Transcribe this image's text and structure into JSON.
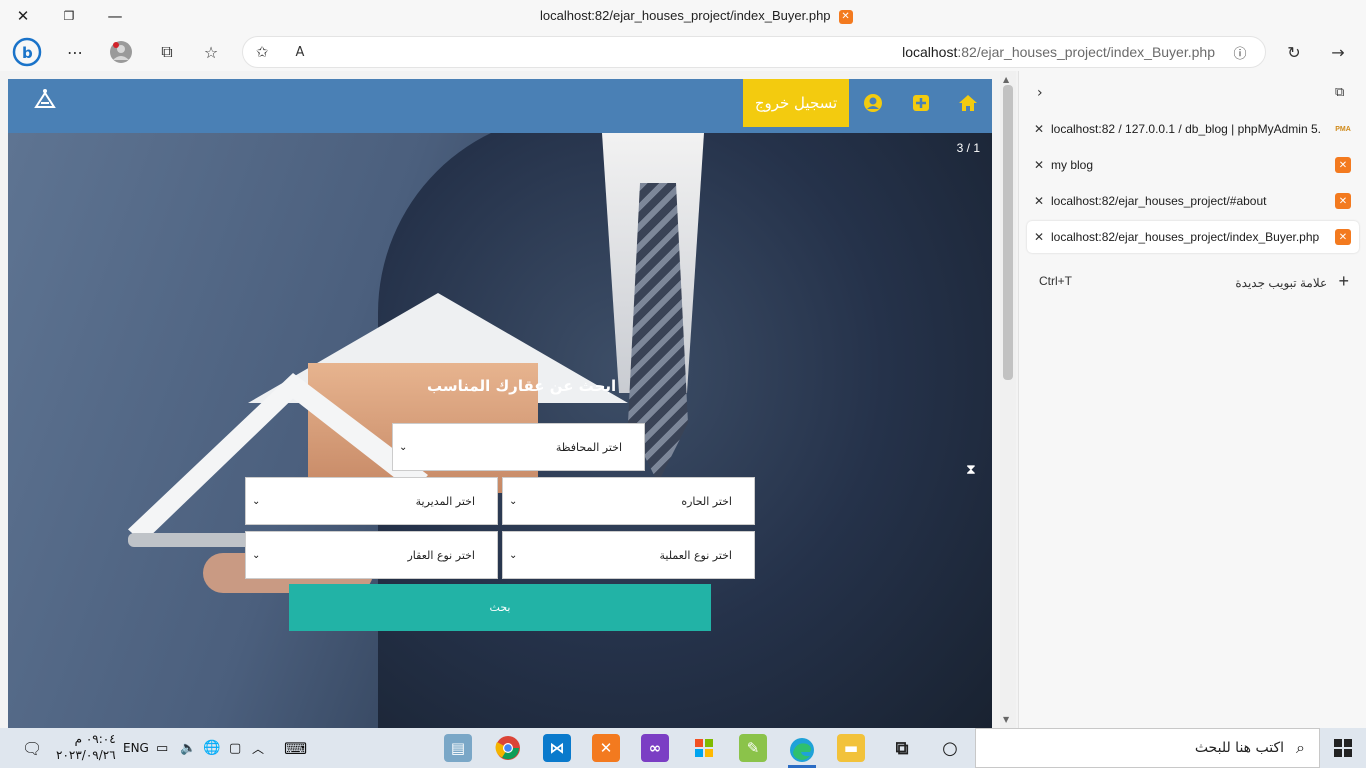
{
  "window": {
    "title": "localhost:82/ejar_houses_project/index_Buyer.php",
    "close_label": "✕",
    "restore_label": "❐",
    "minimize_label": "—"
  },
  "address_bar": {
    "host": "localhost",
    "path": ":82/ejar_houses_project/index_Buyer.php"
  },
  "site": {
    "logout_label": "تسجيل خروج",
    "slide_counter": "3 / 1",
    "search_title": "ابحث عن عقارك المناسب",
    "fields": {
      "governorate": "اختر المحافظة",
      "directorate": "اختر المديرية",
      "neighborhood": "اختر الحاره",
      "property_type": "اختر نوع العقار",
      "operation_type": "اختر نوع العملية"
    },
    "search_button": "بحث"
  },
  "tabs_pane": {
    "tabs": [
      {
        "title": "localhost:82 / 127.0.0.1 / db_blog | phpMyAdmin 5.",
        "favicon": "phpmyadmin-icon",
        "active": false
      },
      {
        "title": "my blog",
        "favicon": "xampp-icon",
        "active": false
      },
      {
        "title": "localhost:82/ejar_houses_project/#about",
        "favicon": "xampp-icon",
        "active": false
      },
      {
        "title": "localhost:82/ejar_houses_project/index_Buyer.php",
        "favicon": "xampp-icon",
        "active": true
      }
    ],
    "new_tab_label": "علامة تبويب جديدة",
    "new_tab_shortcut": "Ctrl+T"
  },
  "taskbar": {
    "language": "ENG",
    "time": "٠٩:٠٤ م",
    "date": "٢٠٢٣/٠٩/٢٦",
    "search_placeholder": "اكتب هنا للبحث"
  },
  "colors": {
    "navbar": "#4a80b5",
    "logout": "#f3cb0f",
    "search_button": "#22b3a6"
  }
}
